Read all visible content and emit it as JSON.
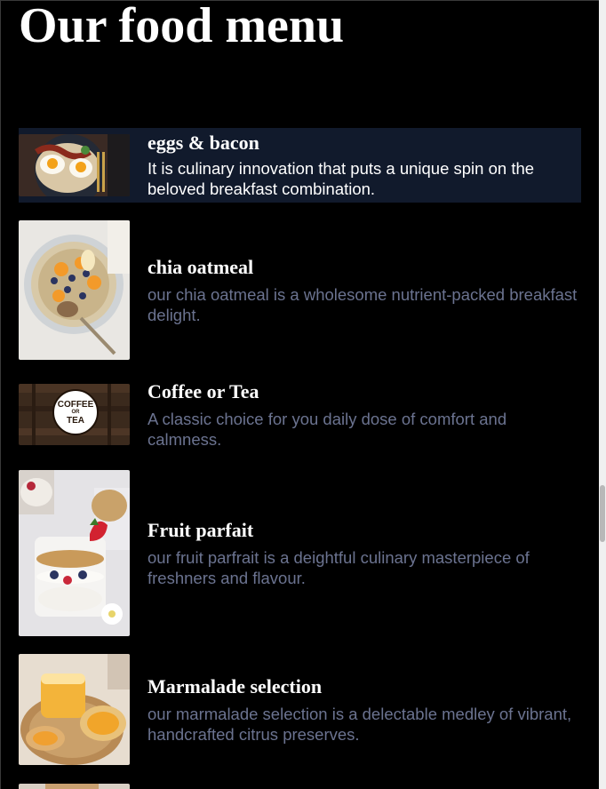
{
  "page": {
    "title": "Our food menu"
  },
  "menu": {
    "items": [
      {
        "name": "eggs & bacon",
        "description": "It is culinary innovation that puts a unique spin on the beloved breakfast combination.",
        "image_icon": "eggs-bacon-photo",
        "highlighted": true
      },
      {
        "name": "chia oatmeal",
        "description": "our chia oatmeal is a wholesome nutrient-packed breakfast delight.",
        "image_icon": "chia-oatmeal-photo",
        "highlighted": false
      },
      {
        "name": "Coffee or Tea",
        "description": "A classic choice for you daily dose of comfort and calmness.",
        "image_icon": "coffee-or-tea-logo",
        "highlighted": false
      },
      {
        "name": "Fruit parfait",
        "description": "our fruit parfrait is a deightful culinary masterpiece of freshners and flavour.",
        "image_icon": "fruit-parfait-photo",
        "highlighted": false
      },
      {
        "name": "Marmalade selection",
        "description": "our marmalade selection is a delectable medley of vibrant, handcrafted citrus preserves.",
        "image_icon": "marmalade-photo",
        "highlighted": false
      }
    ],
    "coffee_logo": {
      "line1": "COFFEE",
      "line2": "OR",
      "line3": "TEA"
    }
  },
  "colors": {
    "background": "#000000",
    "highlight_row": "#111a2c",
    "heading_text": "#ffffff",
    "description_text": "#6b7390"
  }
}
